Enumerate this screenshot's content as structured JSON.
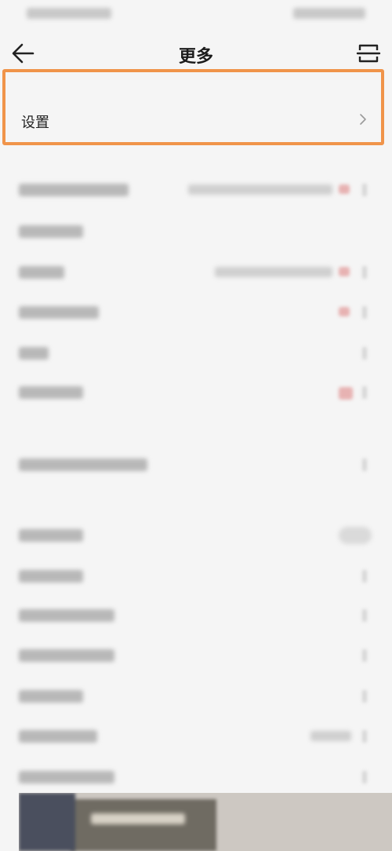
{
  "header": {
    "title": "更多"
  },
  "settings": {
    "label": "设置"
  },
  "icons": {
    "back": "arrow-left-icon",
    "scan": "scan-icon",
    "chevron": "chevron-right-icon"
  },
  "colors": {
    "highlight_border": "#f0944a",
    "background": "#f5f5f5",
    "title_text": "#1a1a1a"
  }
}
